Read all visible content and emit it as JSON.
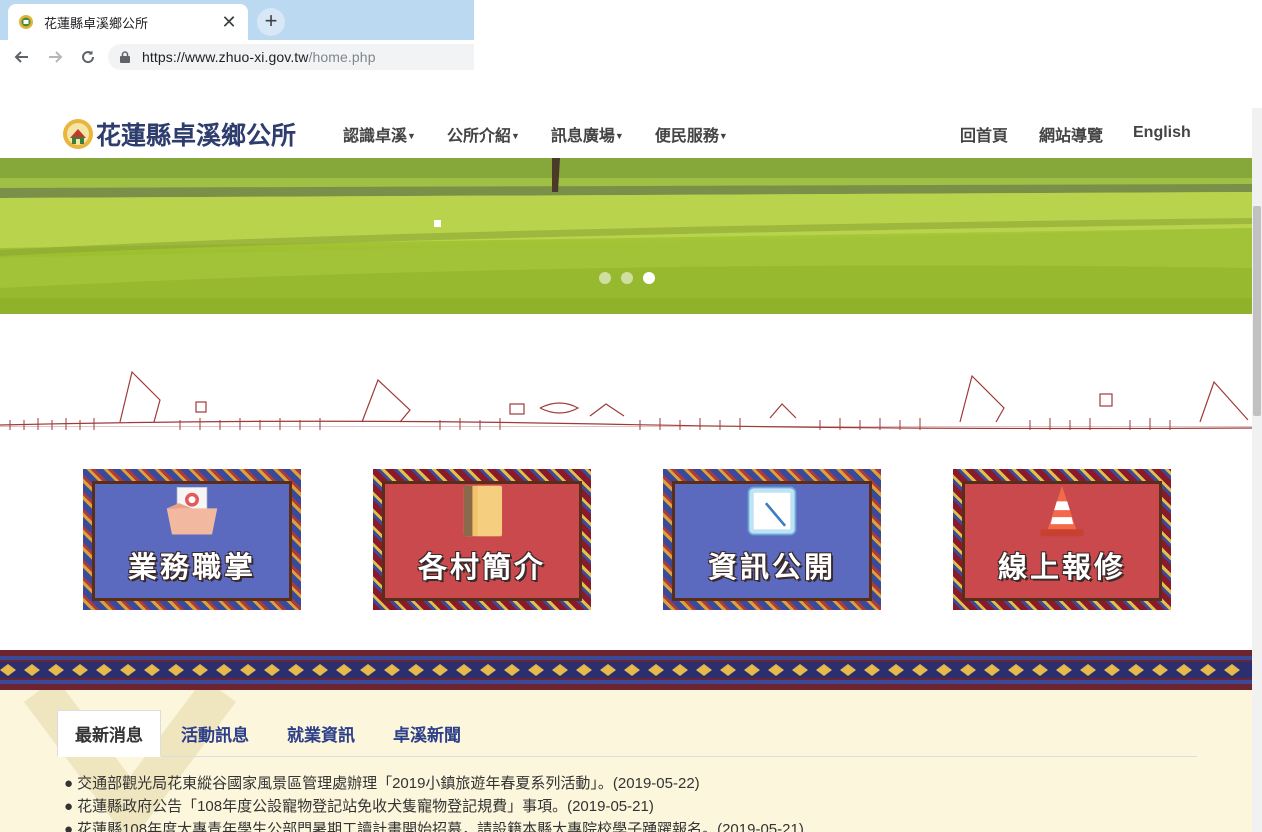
{
  "browser": {
    "tab_title": "花蓮縣卓溪鄉公所",
    "close_glyph": "✕",
    "newtab_glyph": "+",
    "url_domain": "https://www.zhuo-xi.gov.tw",
    "url_path": "/home.php"
  },
  "header": {
    "logo_text": "花蓮縣卓溪鄉公所",
    "nav": [
      {
        "label": "認識卓溪"
      },
      {
        "label": "公所介紹"
      },
      {
        "label": "訊息廣場"
      },
      {
        "label": "便民服務"
      }
    ],
    "caret": "▼",
    "home_label": "回首頁",
    "sitemap_label": "網站導覽",
    "english_label": "English"
  },
  "carousel": {
    "slide_count": 3,
    "active_index": 2
  },
  "tiles": [
    {
      "label": "業務職掌",
      "style": "blue",
      "icon": "box-icon"
    },
    {
      "label": "各村簡介",
      "style": "red",
      "icon": "notebook-icon"
    },
    {
      "label": "資訊公開",
      "style": "blue",
      "icon": "notepad-icon"
    },
    {
      "label": "線上報修",
      "style": "red",
      "icon": "traffic-cone-icon"
    }
  ],
  "news": {
    "tabs": [
      {
        "label": "最新消息",
        "active": true
      },
      {
        "label": "活動訊息",
        "active": false
      },
      {
        "label": "就業資訊",
        "active": false
      },
      {
        "label": "卓溪新聞",
        "active": false
      }
    ],
    "bullet": "●",
    "items": [
      "交通部觀光局花東縱谷國家風景區管理處辦理「2019小鎮旅遊年春夏系列活動」。(2019-05-22)",
      "花蓮縣政府公告「108年度公設寵物登記站免收犬隻寵物登記規費」事項。(2019-05-21)",
      "花蓮縣108年度大專青年學生公部門暑期工讀計畫開始招募，請設籍本縣大專院校學子踴躍報名。(2019-05-21)"
    ]
  },
  "colors": {
    "logo": "#2e3d6e",
    "tile_blue": "#5b69bf",
    "tile_red": "#c9494c",
    "news_tab_text": "#2e3f8a",
    "news_bg": "#fbf6dc"
  }
}
